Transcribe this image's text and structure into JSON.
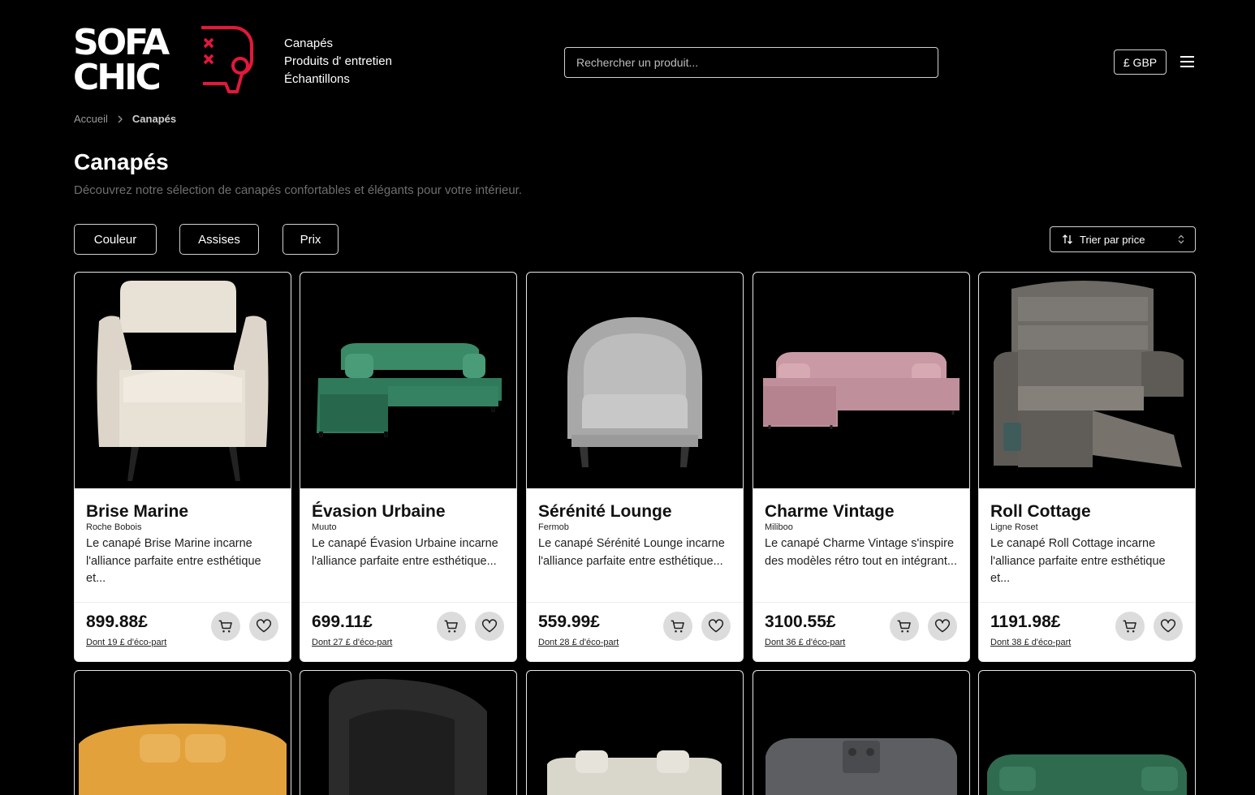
{
  "header": {
    "logo_text": "SOFA CHIC",
    "nav": [
      "Canapés",
      "Produits d' entretien",
      "Échantillons"
    ],
    "search_placeholder": "Rechercher un produit...",
    "currency": "£ GBP"
  },
  "breadcrumb": {
    "home": "Accueil",
    "current": "Canapés"
  },
  "page": {
    "title": "Canapés",
    "subtitle": "Découvrez notre sélection de canapés confortables et élégants pour votre intérieur."
  },
  "filters": [
    "Couleur",
    "Assises",
    "Prix"
  ],
  "sort_label": "Trier par price",
  "colors": {
    "accent": "#e3183a",
    "background": "#000000",
    "button_gray": "#dcdcdc"
  },
  "products": [
    {
      "name": "Brise Marine",
      "brand": "Roche Bobois",
      "description": "Le canapé Brise Marine incarne l'alliance parfaite entre esthétique et...",
      "price": "899.88£",
      "eco": "Dont 19 £ d'éco-part",
      "image": "armchair-cream"
    },
    {
      "name": "Évasion Urbaine",
      "brand": "Muuto",
      "description": "Le canapé Évasion Urbaine incarne l'alliance parfaite entre esthétique...",
      "price": "699.11£",
      "eco": "Dont 27 £ d'éco-part",
      "image": "corner-sofa-green"
    },
    {
      "name": "Sérénité Lounge",
      "brand": "Fermob",
      "description": "Le canapé Sérénité Lounge incarne l'alliance parfaite entre esthétique...",
      "price": "559.99£",
      "eco": "Dont 28 £ d'éco-part",
      "image": "tub-chair-gray"
    },
    {
      "name": "Charme Vintage",
      "brand": "Miliboo",
      "description": "Le canapé Charme Vintage s'inspire des modèles rétro tout en intégrant...",
      "price": "3100.55£",
      "eco": "Dont 36 £ d'éco-part",
      "image": "corner-sofa-pink"
    },
    {
      "name": "Roll Cottage",
      "brand": "Ligne Roset",
      "description": "Le canapé Roll Cottage incarne l'alliance parfaite entre esthétique et...",
      "price": "1191.98£",
      "eco": "Dont 38 £ d'éco-part",
      "image": "recliner-gray"
    }
  ],
  "products_row2_images": [
    "sofa-yellow",
    "tub-chair-black",
    "sofa-beige",
    "sofa-gray-console",
    "sofa-green"
  ]
}
